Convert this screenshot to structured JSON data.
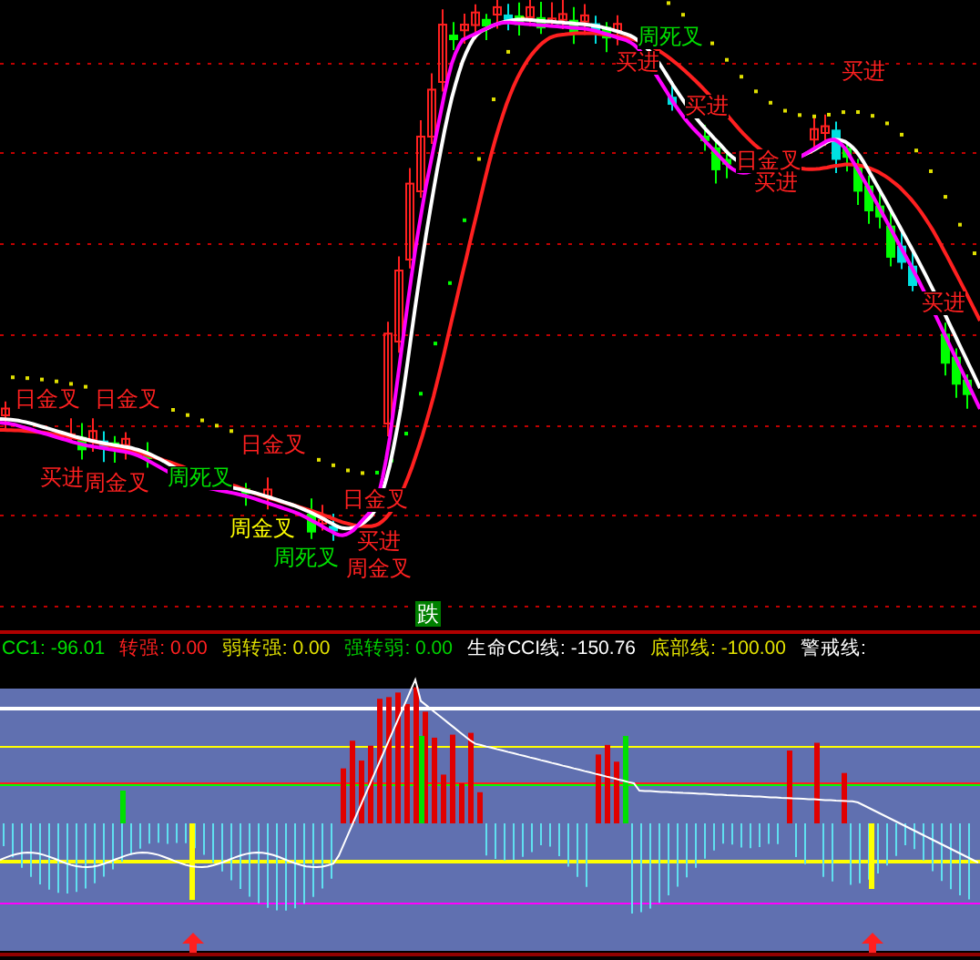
{
  "price_chart": {
    "annotations": [
      {
        "text": "日金叉",
        "color": "#ff2020"
      },
      {
        "text": "日金叉",
        "color": "#ff2020"
      },
      {
        "text": "买进",
        "color": "#ff2020"
      },
      {
        "text": "周金叉",
        "color": "#ff2020"
      },
      {
        "text": "周死叉",
        "color": "#00e000"
      },
      {
        "text": "日金叉",
        "color": "#ff2020"
      },
      {
        "text": "周金叉",
        "color": "#ffff00"
      },
      {
        "text": "周死叉",
        "color": "#00e000"
      },
      {
        "text": "日金叉",
        "color": "#ff2020"
      },
      {
        "text": "买进",
        "color": "#ff2020"
      },
      {
        "text": "周金叉",
        "color": "#ff2020"
      },
      {
        "text": "周死叉",
        "color": "#00e000"
      },
      {
        "text": "买进",
        "color": "#ff2020"
      },
      {
        "text": "买进",
        "color": "#ff2020"
      },
      {
        "text": "买进",
        "color": "#ff2020"
      },
      {
        "text": "日金叉",
        "color": "#ff2020"
      },
      {
        "text": "买进",
        "color": "#ff2020"
      },
      {
        "text": "买进",
        "color": "#ff2020"
      }
    ]
  },
  "signal_badge": "跌",
  "indicator_legend": [
    {
      "text": "CC1: -96.01",
      "color": "#00e000"
    },
    {
      "text": "转强: 0.00",
      "color": "#ff2020"
    },
    {
      "text": "弱转强: 0.00",
      "color": "#e0e000"
    },
    {
      "text": "强转弱: 0.00",
      "color": "#00d000"
    },
    {
      "text": "生命CCI线: -150.76",
      "color": "#ffffff"
    },
    {
      "text": "底部线: -100.00",
      "color": "#e0e000"
    },
    {
      "text": "警戒线:",
      "color": "#ffffff"
    }
  ]
}
